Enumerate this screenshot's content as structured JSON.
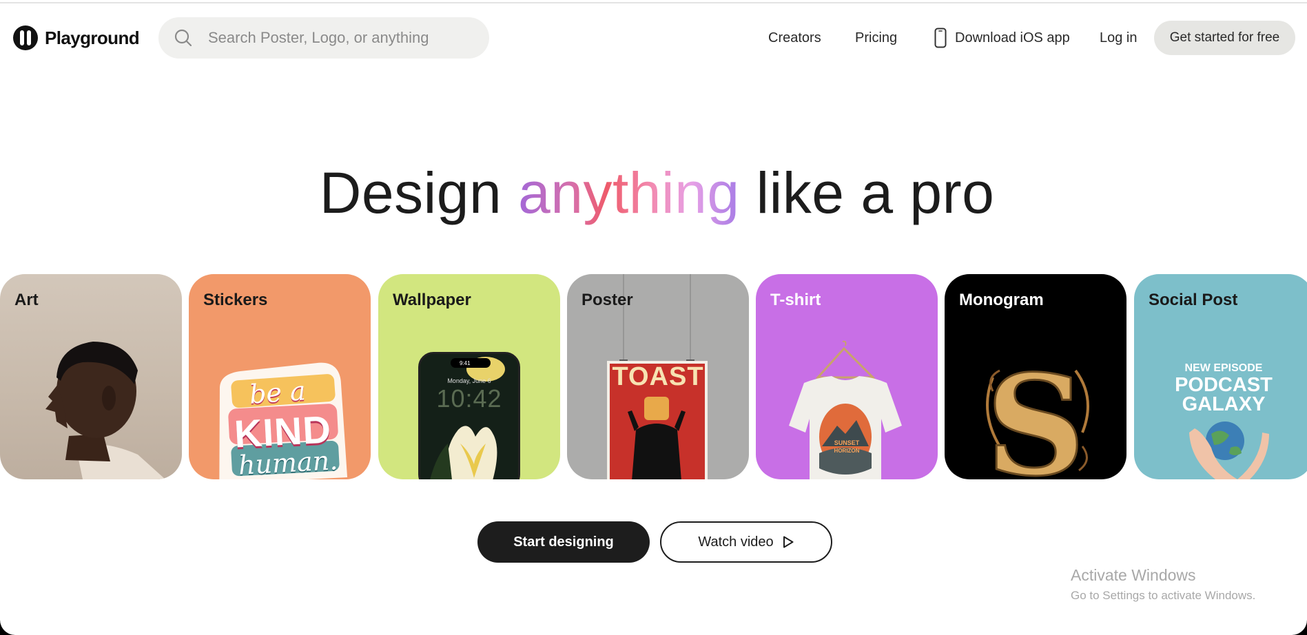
{
  "header": {
    "logo_text": "Playground",
    "search_placeholder": "Search Poster, Logo, or anything",
    "nav": {
      "creators": "Creators",
      "pricing": "Pricing",
      "ios": "Download iOS app",
      "login": "Log in"
    },
    "cta": "Get started for free"
  },
  "hero": {
    "title_before": "Design ",
    "title_highlight": "anything",
    "title_after": " like a pro"
  },
  "categories": [
    {
      "label": "Art",
      "color": "#c9bcae"
    },
    {
      "label": "Stickers",
      "color": "#f2996a"
    },
    {
      "label": "Wallpaper",
      "color": "#d2e67f"
    },
    {
      "label": "Poster",
      "color": "#acacab"
    },
    {
      "label": "T-shirt",
      "color": "#c86fe6"
    },
    {
      "label": "Monogram",
      "color": "#000000"
    },
    {
      "label": "Social Post",
      "color": "#7dbfca"
    }
  ],
  "card_content": {
    "sticker": {
      "line1": "be a",
      "line2": "KIND",
      "line3": "human."
    },
    "wallpaper": {
      "status_time": "9:41",
      "date": "Monday, June 6",
      "clock": "10:42"
    },
    "poster": {
      "title": "TOAST"
    },
    "tshirt": {
      "line1": "SUNSET",
      "line2": "HORIZON"
    },
    "social": {
      "line1": "NEW EPISODE",
      "line2": "PODCAST",
      "line3": "GALAXY"
    }
  },
  "actions": {
    "start": "Start designing",
    "watch": "Watch video"
  },
  "watermark": {
    "title": "Activate Windows",
    "subtitle": "Go to Settings to activate Windows."
  },
  "colors": {
    "primary_button": "#1d1d1d",
    "search_bg": "#f0f0ee",
    "cta_bg": "#e6e6e3"
  }
}
